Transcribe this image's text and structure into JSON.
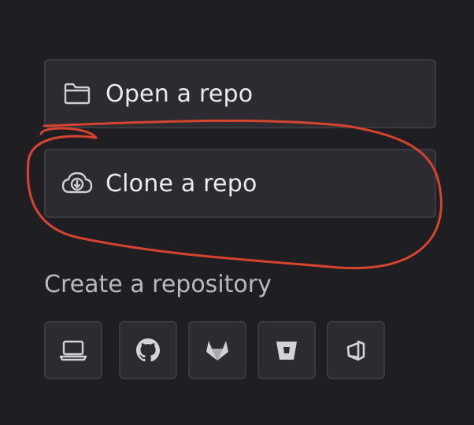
{
  "actions": {
    "open_label": "Open a repo",
    "clone_label": "Clone a repo"
  },
  "create": {
    "title": "Create a repository",
    "providers": [
      {
        "icon": "laptop-icon"
      },
      {
        "icon": "github-icon"
      },
      {
        "icon": "gitlab-icon"
      },
      {
        "icon": "bitbucket-icon"
      },
      {
        "icon": "azure-devops-icon"
      }
    ]
  },
  "colors": {
    "background": "#1f1f23",
    "button_bg": "#2b2b31",
    "button_border": "#3a3a41",
    "text": "#ececef",
    "muted_text": "#b9b9be",
    "annotation": "#d8432f"
  }
}
